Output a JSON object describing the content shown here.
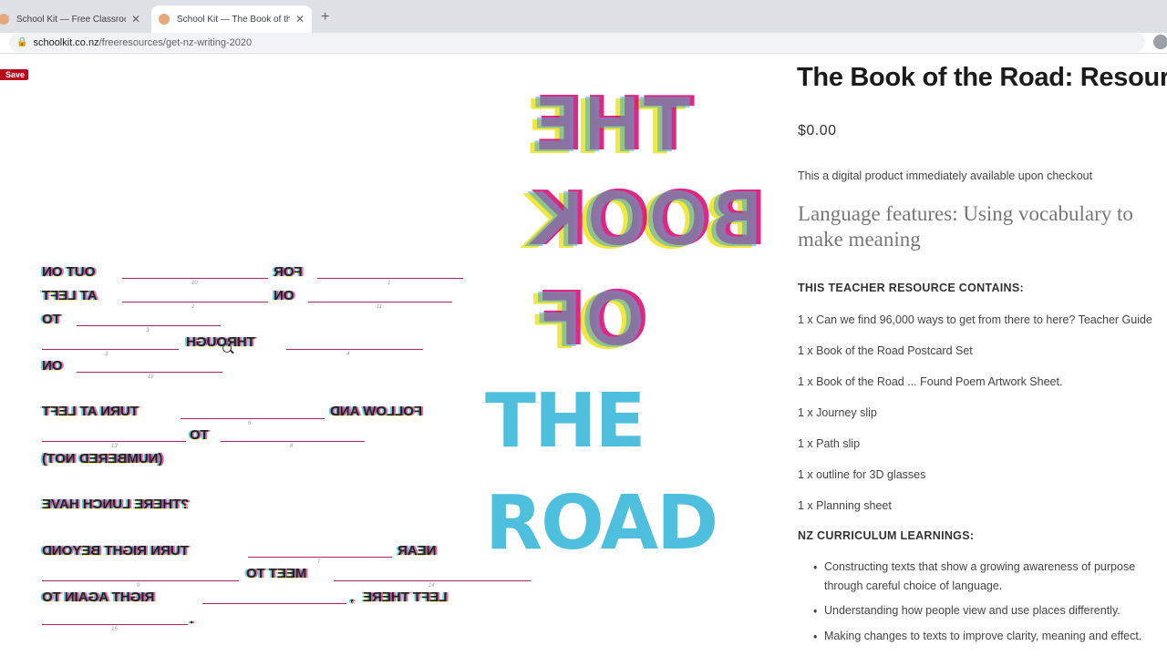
{
  "browser": {
    "tabs": [
      {
        "title": "School Kit — Free Classroom Kits",
        "active": false
      },
      {
        "title": "School Kit — The Book of the Road",
        "active": true
      }
    ],
    "url_domain": "schoolkit.co.nz",
    "url_path": "/freeresources/get-nz-writing-2020"
  },
  "page": {
    "save_button": "Save",
    "artwork": {
      "title_words": [
        "THE",
        "BOOK",
        "OF",
        "THE",
        "ROAD"
      ],
      "poem_words": [
        "OUT ON",
        "FOR",
        "AT LEFT",
        "ON",
        "TO",
        "THROUGH",
        "ON",
        "TURN AT LEFT",
        "FOLLOW AND",
        "TO",
        "(NUMBERED NOT)",
        "?THERE LUNCH HAVE",
        "TURN RIGHT BEYOND",
        "NEAR",
        "MEET TO",
        "RIGHT AGAIN TO",
        "LEFT THERE",
        ",",
        "."
      ],
      "blank_numbers": [
        "10",
        "1",
        "2",
        "11",
        "3",
        "3",
        "4",
        "12",
        "6",
        "13",
        "8",
        "7",
        "9",
        "14",
        "15"
      ]
    },
    "product": {
      "title": "The Book of the Road: Resource",
      "price": "$0.00",
      "note": "This a digital product immediately available upon checkout",
      "subtitle": "Language features: Using vocabulary to make meaning",
      "contains_heading": "THIS TEACHER RESOURCE CONTAINS:",
      "contains_items": [
        "1  x Can we find 96,000 ways to get from there to here? Teacher Guide",
        "1 x Book of the Road Postcard Set",
        "1 x Book of the Road ... Found Poem Artwork Sheet.",
        "1 x Journey slip",
        "1 x Path slip",
        "1 x outline for 3D glasses",
        "1 x Planning sheet"
      ],
      "curriculum_heading": "NZ CURRICULUM LEARNINGS:",
      "curriculum_items": [
        "Constructing texts that show a growing awareness of purpose through careful choice of language.",
        "Understanding how people view and use places differently.",
        "Making changes to texts to improve clarity, meaning and effect."
      ]
    }
  }
}
